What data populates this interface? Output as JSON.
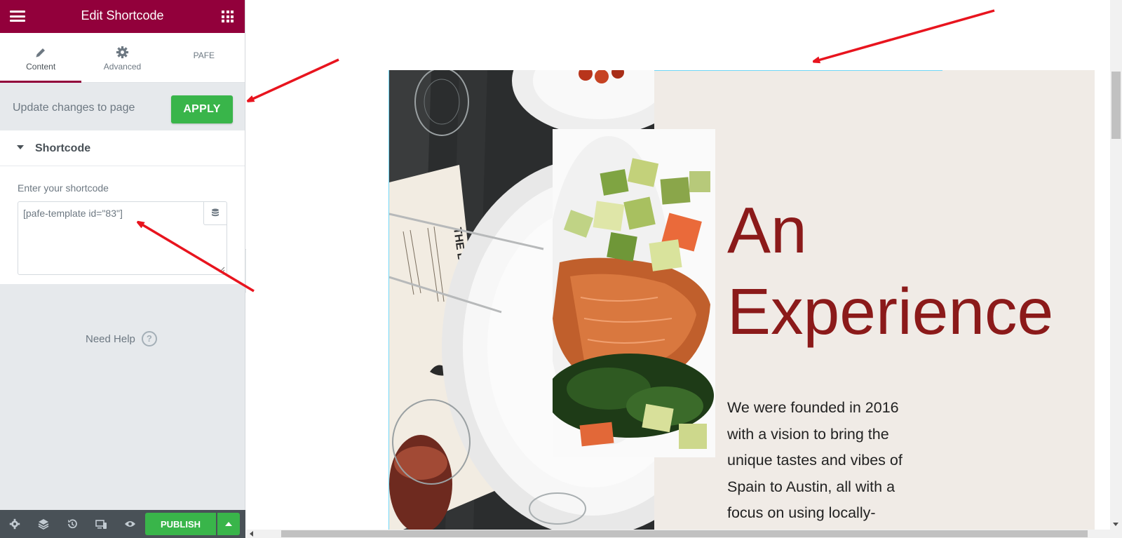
{
  "panel": {
    "title": "Edit Shortcode",
    "tabs": [
      {
        "label": "Content",
        "icon": "pencil-icon",
        "active": true
      },
      {
        "label": "Advanced",
        "icon": "gear-icon",
        "active": false
      },
      {
        "label": "PAFE",
        "icon": "",
        "active": false
      }
    ],
    "apply_text": "Update changes to page",
    "apply_label": "APPLY",
    "section_title": "Shortcode",
    "field_label": "Enter your shortcode",
    "shortcode_value": "[pafe-template id=\"83\"]",
    "need_help": "Need Help",
    "publish_label": "PUBLISH"
  },
  "preview": {
    "heading_line1": "An",
    "heading_line2": "Experience",
    "paragraph": "We were founded in 2016 with a vision to bring the unique tastes and vibes of Spain to Austin, all with a focus on using locally-"
  },
  "colors": {
    "brand": "#92003b",
    "apply_green": "#39b54a",
    "heading_red": "#8b1a1a",
    "canvas_bg": "#f0ebe6",
    "annotation_arrow": "#e8141e"
  }
}
